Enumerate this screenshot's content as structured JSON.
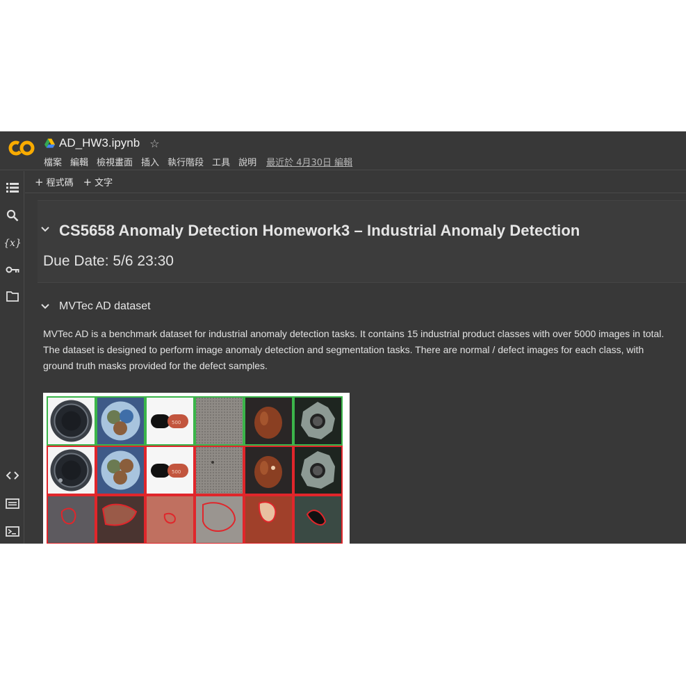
{
  "app": {
    "notebook_title": "AD_HW3.ipynb",
    "logo_text": "CO",
    "menu": [
      "檔案",
      "編輯",
      "檢視畫面",
      "插入",
      "執行階段",
      "工具",
      "說明"
    ],
    "last_edit": "最近於 4月30日 編輯"
  },
  "toolbar": {
    "add_code_label": "程式碼",
    "add_text_label": "文字"
  },
  "rail_icons": [
    "table-of-contents-icon",
    "search-icon",
    "variables-icon",
    "secrets-key-icon",
    "files-folder-icon",
    "code-snippets-icon",
    "command-palette-icon",
    "terminal-icon"
  ],
  "notebook": {
    "heading": "CS5658 Anomaly Detection Homework3 – Industrial Anomaly Detection",
    "due_date": "Due Date: 5/6 23:30",
    "section_title": "MVTec AD dataset",
    "paragraph": "MVTec AD is a benchmark dataset for industrial anomaly detection tasks. It contains 15 industrial product classes with over 5000 images in total. The dataset is designed to perform image anomaly detection and segmentation tasks. There are normal / defect images for each class, with ground truth masks provided for the defect samples."
  },
  "colors": {
    "background": "#383838",
    "normal_border": "#3bb54a",
    "defect_border": "#e0262b",
    "logo_orange": "#f9ab00"
  }
}
